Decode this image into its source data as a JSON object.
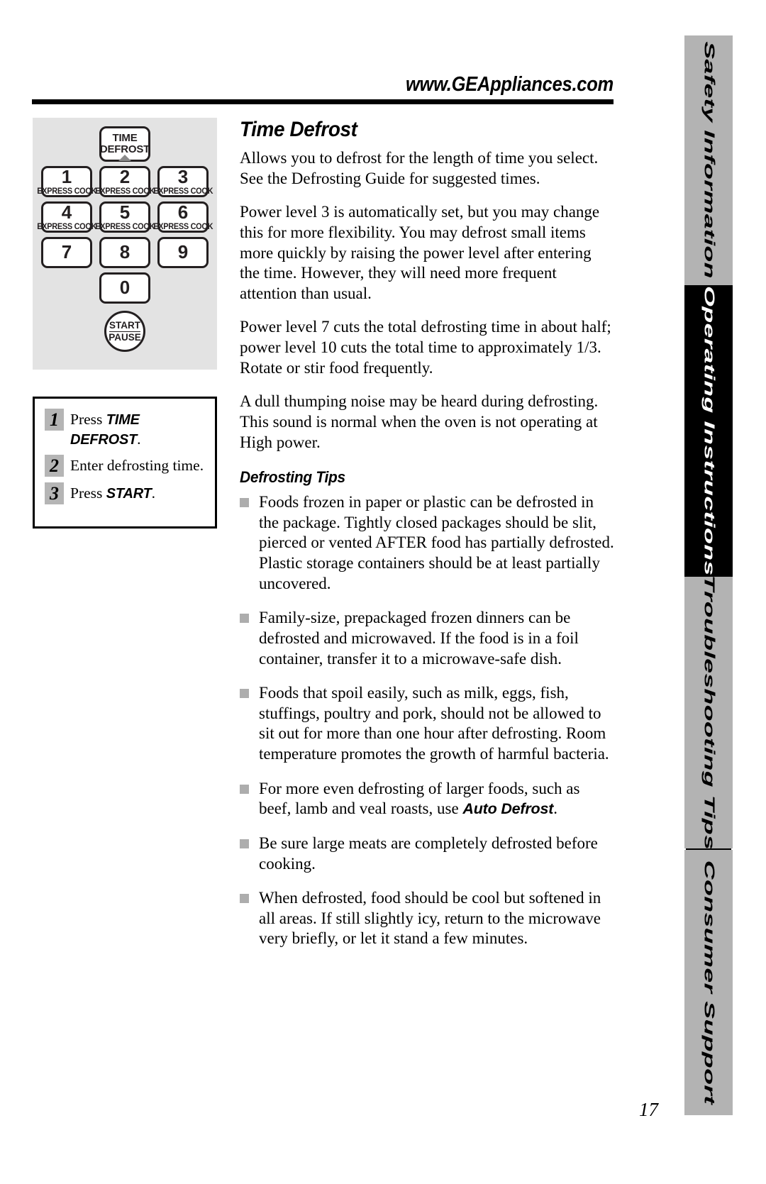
{
  "header": {
    "url": "www.GEAppliances.com"
  },
  "control_panel": {
    "defrost_key": {
      "line1": "TIME",
      "line2": "DEFROST"
    },
    "keys": [
      {
        "digit": "1",
        "sub": "EXPRESS COOK"
      },
      {
        "digit": "2",
        "sub": "EXPRESS COOK"
      },
      {
        "digit": "3",
        "sub": "EXPRESS COOK"
      },
      {
        "digit": "4",
        "sub": "EXPRESS COOK"
      },
      {
        "digit": "5",
        "sub": "EXPRESS COOK"
      },
      {
        "digit": "6",
        "sub": "EXPRESS COOK"
      },
      {
        "digit": "7",
        "sub": ""
      },
      {
        "digit": "8",
        "sub": ""
      },
      {
        "digit": "9",
        "sub": ""
      },
      {
        "digit": "0",
        "sub": ""
      }
    ],
    "start_button": {
      "line1": "START",
      "line2": "PAUSE"
    }
  },
  "steps": [
    {
      "number": "1",
      "pre": "Press ",
      "command": "TIME DEFROST",
      "post": "."
    },
    {
      "number": "2",
      "pre": "Enter defrosting time.",
      "command": "",
      "post": ""
    },
    {
      "number": "3",
      "pre": "Press ",
      "command": "START",
      "post": "."
    }
  ],
  "main": {
    "title": "Time Defrost",
    "paragraphs": [
      "Allows you to defrost for the length of time you select. See the Defrosting Guide for suggested times.",
      "Power level 3 is automatically set, but you may change this for more flexibility. You may defrost small items more quickly by raising the power level after entering the time. However, they will need more frequent attention than usual.",
      "Power level 7 cuts the total defrosting time in about half; power level 10 cuts the total time to approximately 1/3. Rotate or stir food frequently.",
      "A dull thumping noise may be heard during defrosting. This sound is normal when the oven is not operating at High power."
    ],
    "tips_title": "Defrosting Tips",
    "tips": [
      {
        "pre": "Foods frozen in paper or plastic can be defrosted in the package. Tightly closed packages should be slit, pierced or vented AFTER food has partially defrosted. Plastic storage containers should be at least partially uncovered.",
        "command": "",
        "post": ""
      },
      {
        "pre": "Family-size, prepackaged frozen dinners can be defrosted and microwaved. If the food is in a foil container, transfer it to a microwave-safe dish.",
        "command": "",
        "post": ""
      },
      {
        "pre": "Foods that spoil easily, such as milk, eggs, fish, stuffings, poultry and pork, should not be allowed to sit out for more than one hour after defrosting. Room temperature promotes the growth of harmful bacteria.",
        "command": "",
        "post": ""
      },
      {
        "pre": "For more even defrosting of larger foods, such as beef, lamb and veal roasts, use ",
        "command": "Auto Defrost",
        "post": "."
      },
      {
        "pre": "Be sure large meats are completely defrosted before cooking.",
        "command": "",
        "post": ""
      },
      {
        "pre": "When defrosted, food should be cool but softened in all areas. If still slightly icy, return to the microwave very briefly, or let it stand a few minutes.",
        "command": "",
        "post": ""
      }
    ]
  },
  "tabs": [
    {
      "label": "Safety Information",
      "active": false
    },
    {
      "label": "Operating Instructions",
      "active": true
    },
    {
      "label": "Troubleshooting Tips",
      "active": false
    },
    {
      "label": "Consumer Support",
      "active": false
    }
  ],
  "footer": {
    "page_number": "17"
  }
}
